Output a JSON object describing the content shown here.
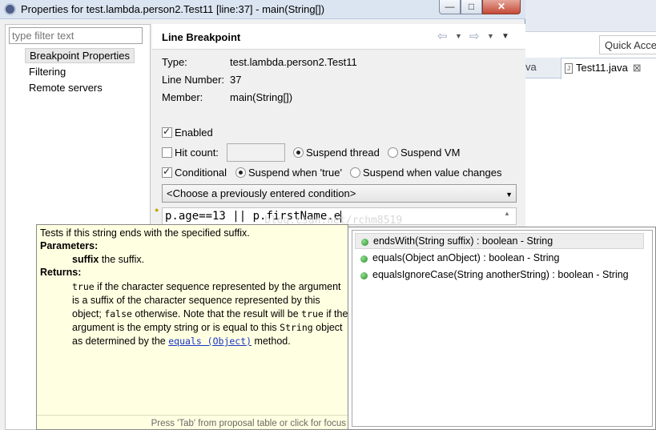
{
  "ide": {
    "quick_access": "Quick Acces",
    "tab_partial": "va",
    "tab_active": "Test11.java",
    "tab_close": "⊠"
  },
  "dialog": {
    "title": "Properties for test.lambda.person2.Test11 [line:37] - main(String[])",
    "filter_placeholder": "type filter text",
    "nav_items": [
      "Breakpoint Properties",
      "Filtering",
      "Remote servers"
    ],
    "header_title": "Line Breakpoint",
    "type_label": "Type:",
    "type_value": "test.lambda.person2.Test11",
    "line_label": "Line Number:",
    "line_value": "37",
    "member_label": "Member:",
    "member_value": "main(String[])",
    "enabled_label": "Enabled",
    "hitcount_label": "Hit count:",
    "hitcount_value": "",
    "suspend_thread": "Suspend thread",
    "suspend_vm": "Suspend VM",
    "conditional_label": "Conditional",
    "when_true": "Suspend when 'true'",
    "when_changes": "Suspend when value changes",
    "condition_combo": "<Choose a previously entered condition>",
    "condition_text": "p.age==13 || p.firstName.e",
    "watermark": "blog.csdn.net/rchm8519"
  },
  "javadoc": {
    "summary": "Tests if this string ends with the specified suffix.",
    "params_heading": "Parameters:",
    "param_name": "suffix",
    "param_desc": " the suffix.",
    "returns_heading": "Returns:",
    "r_true": "true",
    "r_text1": " if the character sequence represented by the argument is a suffix of the character sequence represented by this object; ",
    "r_false": "false",
    "r_text2": " otherwise. Note that the result will be ",
    "r_true2": "true",
    "r_text3": " if the argument is the empty string or is equal to this ",
    "r_string": "String",
    "r_text4": " object as determined by the ",
    "r_link": "equals (Object)",
    "r_text5": " method.",
    "footer": "Press 'Tab' from proposal table or click for focus"
  },
  "proposals": [
    "endsWith(String suffix) : boolean - String",
    "equals(Object anObject) : boolean - String",
    "equalsIgnoreCase(String anotherString) : boolean - String"
  ],
  "state": {
    "enabled": true,
    "hit_count": false,
    "suspend_policy": "thread",
    "conditional": true,
    "condition_mode": "true",
    "selected_proposal": 0
  }
}
